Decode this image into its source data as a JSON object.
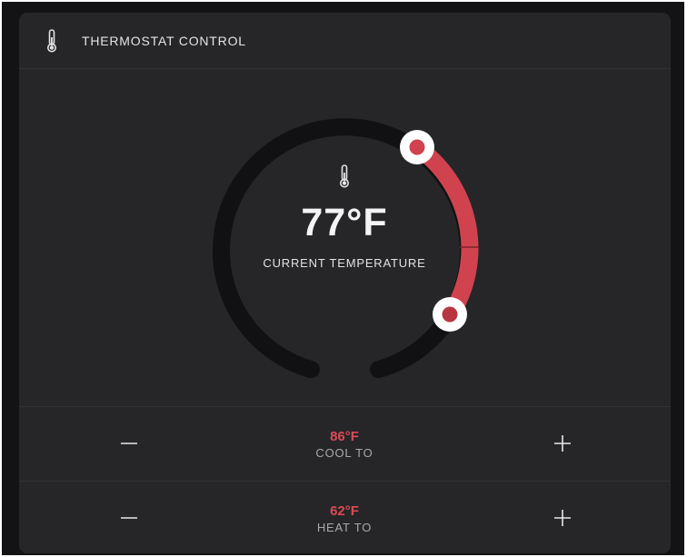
{
  "header": {
    "title": "THERMOSTAT CONTROL",
    "icon": "thermometer-icon"
  },
  "dial": {
    "icon": "thermometer-icon",
    "current_temp": "77°F",
    "current_label": "CURRENT TEMPERATURE"
  },
  "cool": {
    "value": "86°F",
    "label": "COOL TO"
  },
  "heat": {
    "value": "62°F",
    "label": "HEAT TO"
  },
  "colors": {
    "accent": "#dc4a55",
    "card_bg": "#262629",
    "track": "#111113",
    "text": "#f4f4f6"
  }
}
